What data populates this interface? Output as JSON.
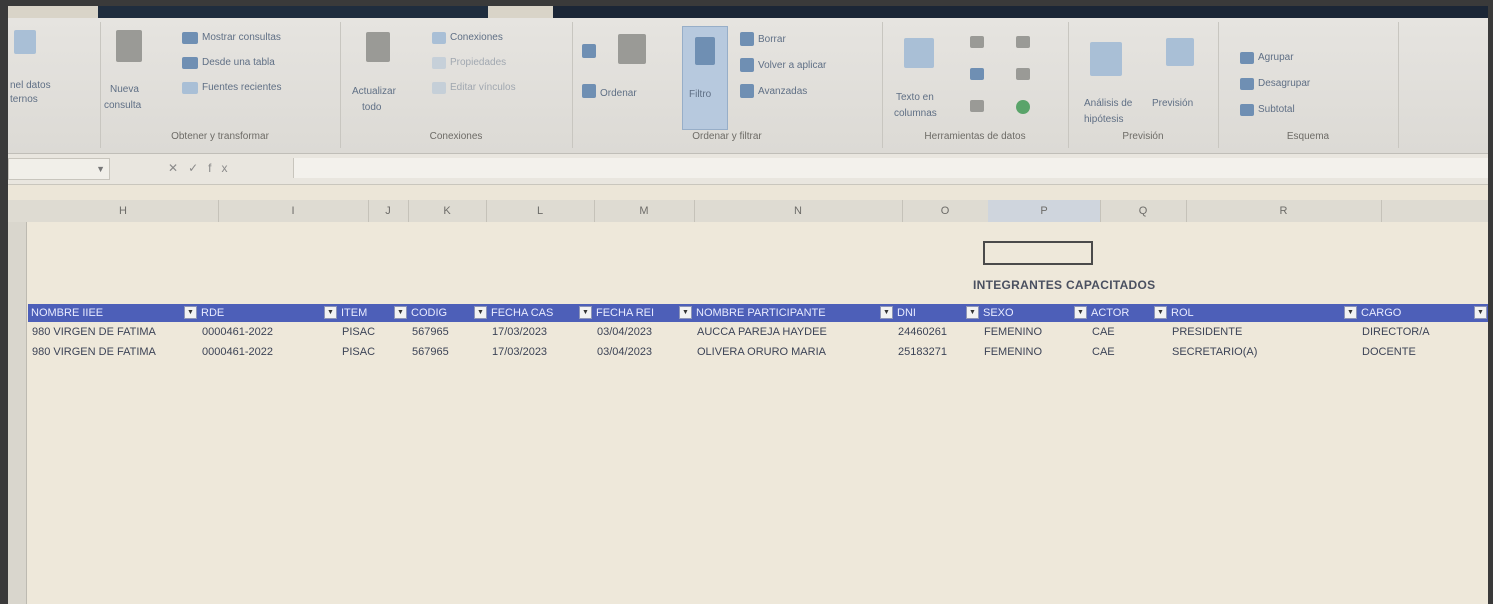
{
  "ribbon": {
    "get_transform": {
      "get_data": "nel datos",
      "get_data2": "ternos",
      "new_query": "Nueva",
      "new_query2": "consulta",
      "show_queries": "Mostrar consultas",
      "from_table": "Desde una tabla",
      "recent_sources": "Fuentes recientes",
      "label": "Obtener y transformar"
    },
    "connections": {
      "refresh_all": "Actualizar",
      "refresh_all2": "todo",
      "connections": "Conexiones",
      "properties": "Propiedades",
      "edit_links": "Editar vínculos",
      "label": "Conexiones"
    },
    "sort_filter": {
      "sort": "Ordenar",
      "filter": "Filtro",
      "clear": "Borrar",
      "reapply": "Volver a aplicar",
      "advanced": "Avanzadas",
      "label": "Ordenar y filtrar"
    },
    "data_tools": {
      "text_to_columns": "Texto en",
      "text_to_columns2": "columnas",
      "label": "Herramientas de datos"
    },
    "forecast": {
      "what_if": "Análisis de",
      "what_if2": "hipótesis",
      "forecast_sheet": "Previsión",
      "label": "Previsión"
    },
    "outline": {
      "group": "Agrupar",
      "ungroup": "Desagrupar",
      "subtotal": "Subtotal",
      "label": "Esquema"
    }
  },
  "formula_bar": {
    "fx": "fx"
  },
  "columns": [
    "H",
    "I",
    "J",
    "K",
    "L",
    "M",
    "N",
    "O",
    "P",
    "Q",
    "R"
  ],
  "sheet": {
    "heading": "INTEGRANTES CAPACITADOS",
    "headers": [
      "NOMBRE IIEE",
      "RDE",
      "ITEM",
      "CODIG",
      "FECHA CAS",
      "FECHA REI",
      "NOMBRE PARTICIPANTE",
      "DNI",
      "SEXO",
      "ACTOR",
      "ROL",
      "CARGO"
    ],
    "rows": [
      [
        "980 VIRGEN DE FATIMA",
        "0000461-2022",
        "PISAC",
        "567965",
        "17/03/2023",
        "03/04/2023",
        "AUCCA PAREJA HAYDEE",
        "24460261",
        "FEMENINO",
        "CAE",
        "PRESIDENTE",
        "DIRECTOR/A"
      ],
      [
        "980 VIRGEN DE FATIMA",
        "0000461-2022",
        "PISAC",
        "567965",
        "17/03/2023",
        "03/04/2023",
        "OLIVERA ORURO MARIA",
        "25183271",
        "FEMENINO",
        "CAE",
        "SECRETARIO(A)",
        "DOCENTE"
      ]
    ]
  },
  "row_numbers": [
    "",
    "",
    "",
    "",
    "",
    "",
    "",
    "",
    "",
    "",
    "",
    "",
    "",
    "",
    "",
    ""
  ],
  "colors": {
    "table_header": "#4d5fb8",
    "ribbon": "#e4e2de",
    "sheet": "#eee8da"
  }
}
